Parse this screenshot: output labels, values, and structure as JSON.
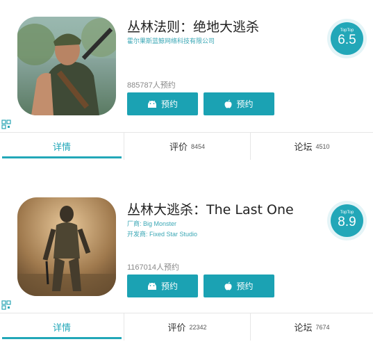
{
  "cards": [
    {
      "title": "丛林法则：绝地大逃杀",
      "sub1": "霍尔果斯蓝鲸网络科技有限公司",
      "sub2": "",
      "reserve": "885787人预约",
      "score_label": "TopTop",
      "score": "6.5",
      "btn_android": "预约",
      "btn_apple": "预约",
      "tabs": [
        {
          "label": "详情",
          "count": ""
        },
        {
          "label": "评价",
          "count": "8454"
        },
        {
          "label": "论坛",
          "count": "4510"
        }
      ]
    },
    {
      "title": "丛林大逃杀：The Last One",
      "sub1": "厂商: Big Monster",
      "sub2": "开发商: Fixed Star Studio",
      "reserve": "1167014人预约",
      "score_label": "TopTop",
      "score": "8.9",
      "btn_android": "预约",
      "btn_apple": "预约",
      "tabs": [
        {
          "label": "详情",
          "count": ""
        },
        {
          "label": "评价",
          "count": "22342"
        },
        {
          "label": "论坛",
          "count": "7674"
        }
      ]
    }
  ],
  "colors": {
    "accent": "#1ba2b3",
    "score_ring": "#e4f4f7",
    "sub_text": "#3aa7b5"
  }
}
